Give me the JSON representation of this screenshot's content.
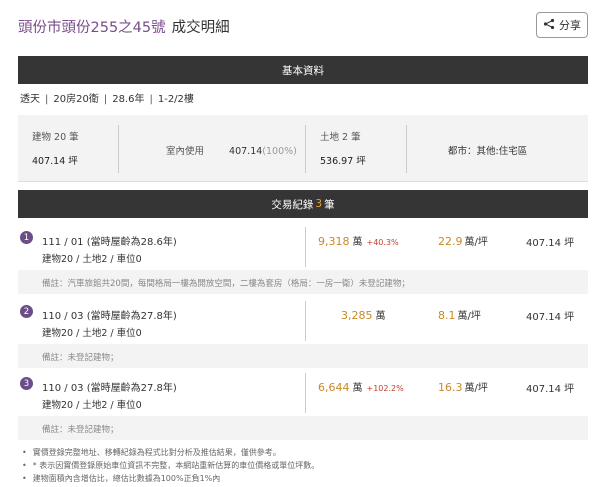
{
  "header": {
    "address": "頭份市頭份255之45號",
    "suffix": "成交明細",
    "share_label": "分享"
  },
  "basic": {
    "section_title": "基本資料",
    "building_type": "透天",
    "rooms": "20房20衛",
    "age": "28.6年",
    "floor": "1-2/2樓"
  },
  "summary": {
    "building_label": "建物 20 筆",
    "building_value": "407.14 坪",
    "indoor_label": "室內使用",
    "indoor_value": "407.14",
    "indoor_pct": "(100%)",
    "land_label": "土地 2 筆",
    "land_value": "536.97 坪",
    "zoning": "都市：其他:住宅區"
  },
  "records_header": {
    "prefix": "交易紀錄",
    "count": "3",
    "suffix": "筆"
  },
  "records": [
    {
      "num": "1",
      "date": "111 / 01",
      "age": "(當時屋齡為28.6年)",
      "sub": "建物20 / 土地2 / 車位0",
      "price": "9,318",
      "price_unit": "萬",
      "change": "+40.3%",
      "unit_price": "22.9",
      "unit_price_unit": "萬/坪",
      "area": "407.14 坪",
      "note": "備註：汽車旅館共20間，每間格局一樓為開放空間，二樓為套房（格局：一房一衛）未登記建物；"
    },
    {
      "num": "2",
      "date": "110 / 03",
      "age": "(當時屋齡為27.8年)",
      "sub": "建物20 / 土地2 / 車位0",
      "price": "3,285",
      "price_unit": "萬",
      "change": "",
      "unit_price": "8.1",
      "unit_price_unit": "萬/坪",
      "area": "407.14 坪",
      "note": "備註：未登記建物；"
    },
    {
      "num": "3",
      "date": "110 / 03",
      "age": "(當時屋齡為27.8年)",
      "sub": "建物20 / 土地2 / 車位0",
      "price": "6,644",
      "price_unit": "萬",
      "change": "+102.2%",
      "unit_price": "16.3",
      "unit_price_unit": "萬/坪",
      "area": "407.14 坪",
      "note": "備註：未登記建物；"
    }
  ],
  "footnotes": [
    "實價登錄完整地址、移轉紀錄為程式比對分析及推估結果，僅供參考。",
    "* 表示因實價登錄原始車位資訊不完整，本網站重新估算的車位價格或單位坪數。",
    "建物面積內含增估比，總估比數據為100%正負1%內"
  ],
  "colors": {
    "accent": "#7a4e8c",
    "price": "#c88a24",
    "change": "#c83c2c",
    "bar": "#353535"
  }
}
